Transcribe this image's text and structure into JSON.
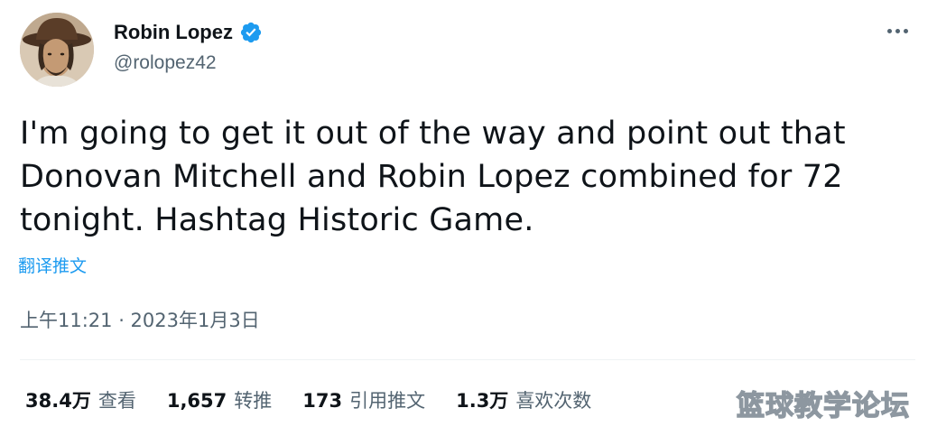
{
  "user": {
    "display_name": "Robin Lopez",
    "handle": "@rolopez42",
    "verified": true,
    "verified_color": "#1d9bf0"
  },
  "tweet": {
    "text_lines": [
      "I'm going to get it out of the way and point out that",
      "Donovan Mitchell and Robin Lopez combined for 72",
      "tonight. Hashtag Historic Game."
    ],
    "translate_label": "翻译推文",
    "timestamp": "上午11:21 · 2023年1月3日"
  },
  "stats": [
    {
      "value": "38.4万",
      "label": "查看"
    },
    {
      "value": "1,657",
      "label": "转推"
    },
    {
      "value": "173",
      "label": "引用推文"
    },
    {
      "value": "1.3万",
      "label": "喜欢次数"
    }
  ],
  "watermark": "篮球教学论坛",
  "icons": {
    "more": "more-horizontal-icon",
    "verified": "verified-badge-icon"
  },
  "colors": {
    "text_primary": "#0f1419",
    "text_secondary": "#536471",
    "link": "#1d9bf0",
    "divider": "#eff3f4"
  }
}
